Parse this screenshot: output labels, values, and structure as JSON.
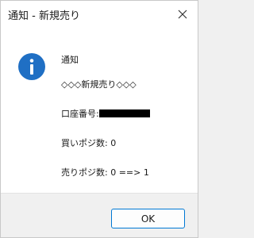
{
  "dialog": {
    "title": "通知 - 新規売り",
    "icons": {
      "info": "info-icon",
      "close": "close-icon"
    },
    "message": {
      "heading": "通知",
      "line1": "◇◇◇新規売り◇◇◇",
      "account_label": "口座番号:",
      "buy_positions": "買いポジ数: 0",
      "sell_positions": "売りポジ数: 0 ==> 1"
    },
    "buttons": {
      "ok": "OK"
    }
  },
  "colors": {
    "accent": "#0078d4",
    "info_icon": "#1f6fc4",
    "footer_bg": "#f0f0f0"
  }
}
